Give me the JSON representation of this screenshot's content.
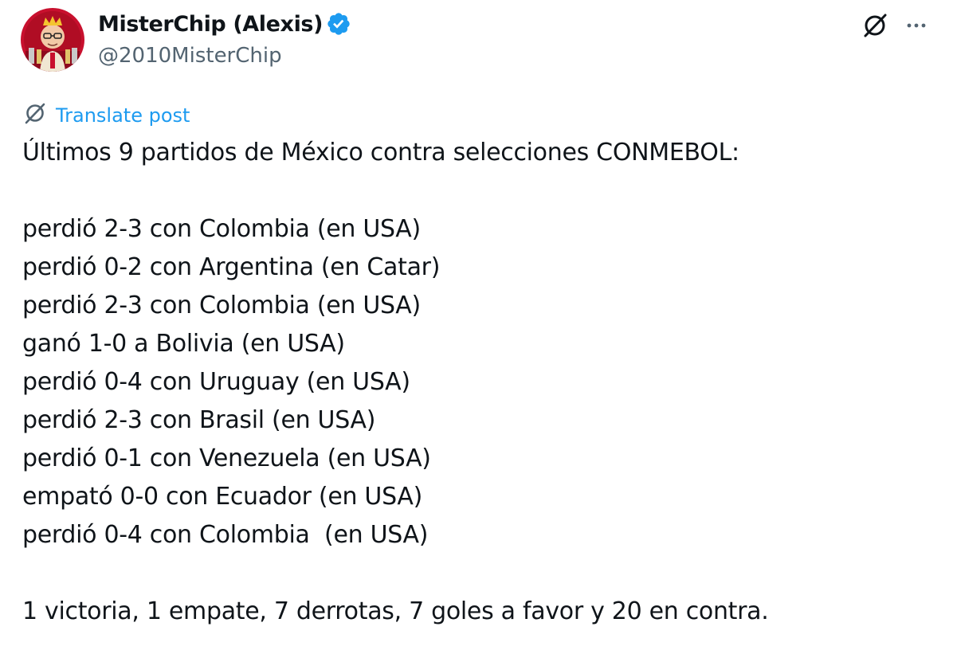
{
  "author": {
    "name": "MisterChip (Alexis)",
    "handle": "@2010MisterChip",
    "verified": true,
    "avatar_icon": "cartoon-avatar"
  },
  "actions": {
    "grok_icon": "grok-icon",
    "more_icon": "more-icon"
  },
  "translate": {
    "label": "Translate post",
    "icon": "translate-icon"
  },
  "post": {
    "intro": "Últimos 9 partidos de México contra selecciones CONMEBOL:",
    "matches": [
      "perdió 2-3 con Colombia (en USA)",
      "perdió 0-2 con Argentina (en Catar)",
      "perdió 2-3 con Colombia (en USA)",
      "ganó 1-0 a Bolivia (en USA)",
      "perdió 0-4 con Uruguay (en USA)",
      "perdió 2-3 con Brasil (en USA)",
      "perdió 0-1 con Venezuela (en USA)",
      "empató 0-0 con Ecuador (en USA)",
      "perdió 0-4 con Colombia  (en USA)"
    ],
    "summary": "1 victoria, 1 empate, 7 derrotas, 7 goles a favor y 20 en contra."
  },
  "colors": {
    "text": "#0f1419",
    "secondary": "#536471",
    "link": "#1d9bf0",
    "verified": "#1d9bf0",
    "avatar_bg": "#c8102e"
  }
}
